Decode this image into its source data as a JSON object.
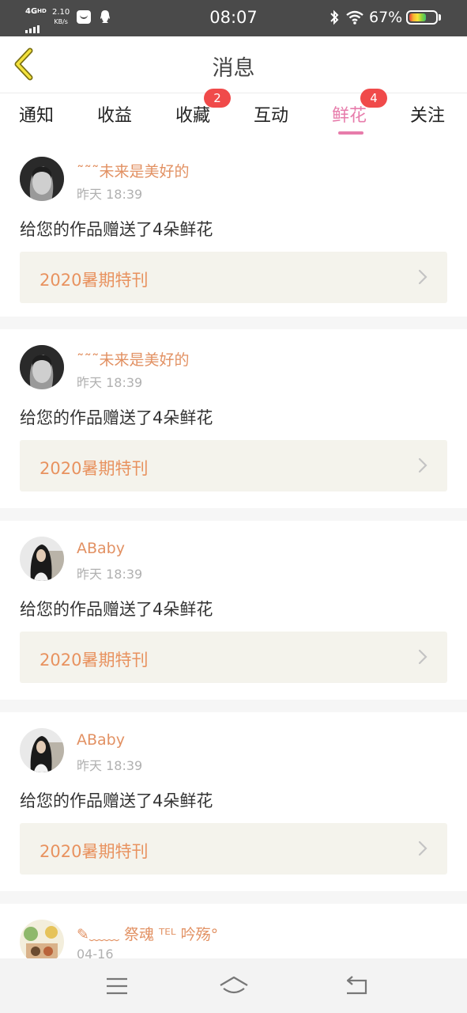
{
  "status_bar": {
    "network": "4G",
    "network_sub": "HD",
    "speed_value": "2.10",
    "speed_unit": "KB/s",
    "time": "08:07",
    "battery_percent": "67%",
    "battery_level": 0.67,
    "icons": [
      "signal-icon",
      "mail-icon",
      "qq-icon",
      "bluetooth-icon",
      "wifi-icon",
      "battery-icon"
    ]
  },
  "header": {
    "title": "消息",
    "back_icon": "chevron-left-icon"
  },
  "tabs": [
    {
      "label": "通知"
    },
    {
      "label": "收益"
    },
    {
      "label": "收藏",
      "badge": "2"
    },
    {
      "label": "互动"
    },
    {
      "label": "鲜花",
      "badge": "4",
      "active": true
    },
    {
      "label": "关注"
    }
  ],
  "messages": [
    {
      "user": "˜˜˜未来是美好的",
      "time": "昨天 18:39",
      "text": "给您的作品赠送了4朵鲜花",
      "work_title": "2020暑期特刊"
    },
    {
      "user": "˜˜˜未来是美好的",
      "time": "昨天 18:39",
      "text": "给您的作品赠送了4朵鲜花",
      "work_title": "2020暑期特刊"
    },
    {
      "user": "ABaby",
      "time": "昨天 18:39",
      "text": "给您的作品赠送了4朵鲜花",
      "work_title": "2020暑期特刊"
    },
    {
      "user": "ABaby",
      "time": "昨天 18:39",
      "text": "给您的作品赠送了4朵鲜花",
      "work_title": "2020暑期特刊"
    },
    {
      "user": "✎﹏﹏ 祭魂 ᵀᴱᴸ 吟殇°",
      "time": "04-16"
    }
  ],
  "nav_bar": {
    "icons": [
      "menu-icon",
      "home-icon",
      "back-icon"
    ]
  },
  "colors": {
    "accent": "#e77cab",
    "username": "#e29163",
    "work_title": "#e8925f",
    "badge": "#f04a4a",
    "work_bg": "#f4f3ec",
    "status_bar": "#4a4a4a"
  }
}
